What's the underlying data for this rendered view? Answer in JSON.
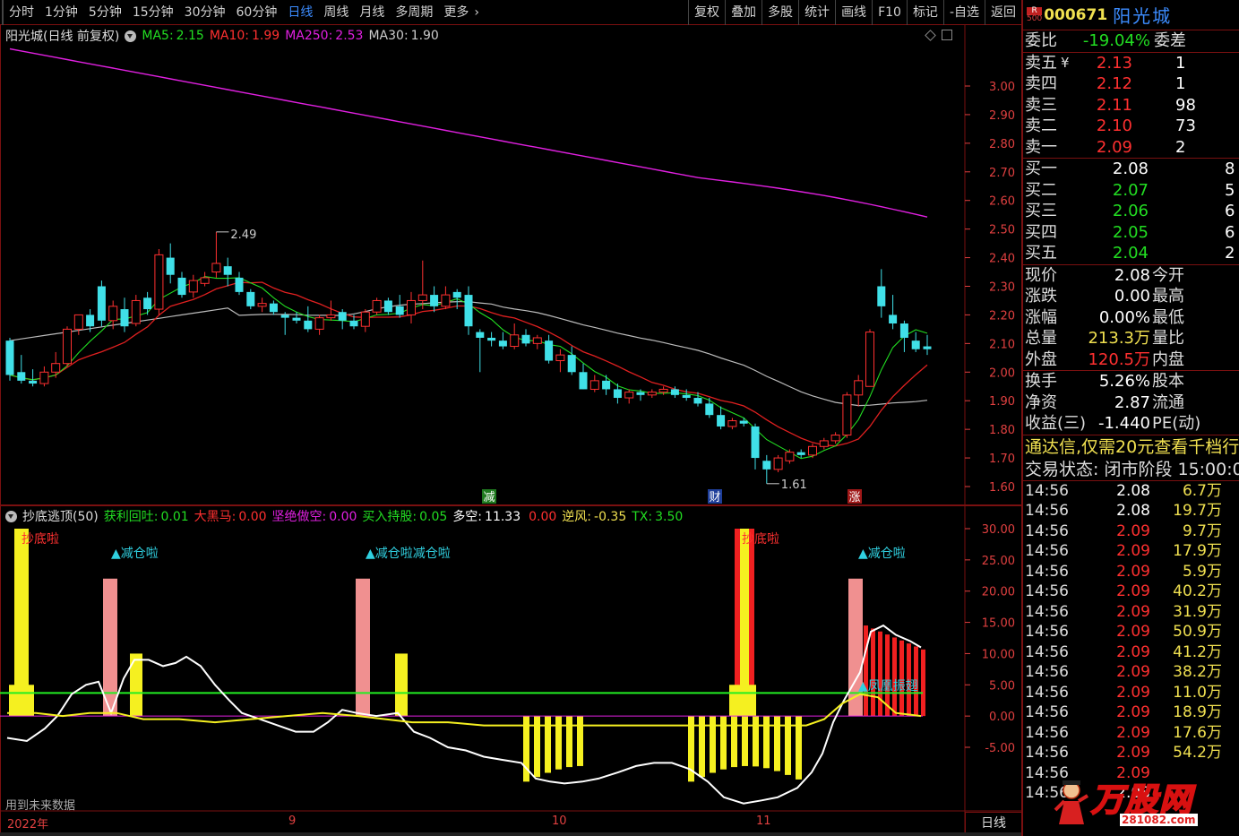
{
  "toolbar": {
    "tabs": [
      "分时",
      "1分钟",
      "5分钟",
      "15分钟",
      "30分钟",
      "60分钟",
      "日线",
      "周线",
      "月线",
      "多周期",
      "更多"
    ],
    "active_tab": "日线",
    "right_tools": [
      "复权",
      "叠加",
      "多股",
      "统计",
      "画线",
      "F10",
      "标记",
      "-自选",
      "返回"
    ]
  },
  "main_chart": {
    "title": "阳光城(日线 前复权)",
    "ma": [
      {
        "label": "MA5:",
        "value": "2.15",
        "color": "#22dd22"
      },
      {
        "label": "MA10:",
        "value": "1.99",
        "color": "#ff3030"
      },
      {
        "label": "MA250:",
        "value": "2.53",
        "color": "#e020e0"
      },
      {
        "label": "MA30:",
        "value": "1.90",
        "color": "#cccccc"
      }
    ],
    "y_ticks": [
      "3.00",
      "2.90",
      "2.80",
      "2.70",
      "2.60",
      "2.50",
      "2.40",
      "2.30",
      "2.20",
      "2.10",
      "2.00",
      "1.90",
      "1.80",
      "1.70",
      "1.60"
    ],
    "high_label": "2.49",
    "low_label": "1.61",
    "markers": [
      "减",
      "财",
      "涨"
    ]
  },
  "indicator": {
    "title": "抄底逃顶(50)",
    "fields": [
      {
        "label": "获利回吐:",
        "value": "0.01",
        "color": "#22dd22"
      },
      {
        "label": "大黑马:",
        "value": "0.00",
        "color": "#ff3030"
      },
      {
        "label": "坚绝做空:",
        "value": "0.00",
        "color": "#e020e0"
      },
      {
        "label": "买入持股:",
        "value": "0.05",
        "color": "#22dd22"
      },
      {
        "label": "多空:",
        "value": "11.33",
        "color": "#ffffff"
      },
      {
        "label": "",
        "value": "0.00",
        "color": "#ff3030"
      },
      {
        "label": "逆风:",
        "value": "-0.35",
        "color": "#f0e050"
      },
      {
        "label": "TX:",
        "value": "3.50",
        "color": "#22dd22"
      }
    ],
    "y_ticks": [
      "30.00",
      "25.00",
      "20.00",
      "15.00",
      "10.00",
      "5.00",
      "0.00",
      "-5.00"
    ],
    "annotations": [
      "抄底啦",
      "▲减仓啦",
      "▲减仓啦减仓啦",
      "抄底啦",
      "▲减仓啦",
      "▲凤凰振翅"
    ],
    "note": "用到未来数据"
  },
  "dates": [
    "2022年",
    "9",
    "10",
    "11"
  ],
  "period_label": "日线",
  "panel": {
    "rank_label": "R",
    "rank_value": "500",
    "code": "000671",
    "name": "阳光城",
    "weibi": {
      "label": "委比",
      "value": "-19.04%",
      "label2": "委差"
    },
    "asks": [
      {
        "label": "卖五",
        "mark": "¥",
        "price": "2.13",
        "vol": "1"
      },
      {
        "label": "卖四",
        "mark": "",
        "price": "2.12",
        "vol": "1"
      },
      {
        "label": "卖三",
        "mark": "",
        "price": "2.11",
        "vol": "98"
      },
      {
        "label": "卖二",
        "mark": "",
        "price": "2.10",
        "vol": "73"
      },
      {
        "label": "卖一",
        "mark": "",
        "price": "2.09",
        "vol": "2"
      }
    ],
    "bids": [
      {
        "label": "买一",
        "price": "2.08",
        "vol": "8"
      },
      {
        "label": "买二",
        "price": "2.07",
        "vol": "5"
      },
      {
        "label": "买三",
        "price": "2.06",
        "vol": "6"
      },
      {
        "label": "买四",
        "price": "2.05",
        "vol": "6"
      },
      {
        "label": "买五",
        "price": "2.04",
        "vol": "2"
      }
    ],
    "quote1": [
      {
        "l": "现价",
        "v": "2.08",
        "c": "white",
        "l2": "今开"
      },
      {
        "l": "涨跌",
        "v": "0.00",
        "c": "white",
        "l2": "最高"
      },
      {
        "l": "涨幅",
        "v": "0.00%",
        "c": "white",
        "l2": "最低"
      },
      {
        "l": "总量",
        "v": "213.3万",
        "c": "yellow",
        "l2": "量比"
      },
      {
        "l": "外盘",
        "v": "120.5万",
        "c": "red",
        "l2": "内盘"
      }
    ],
    "quote2": [
      {
        "l": "换手",
        "v": "5.26%",
        "c": "white",
        "l2": "股本"
      },
      {
        "l": "净资",
        "v": "2.87",
        "c": "white",
        "l2": "流通"
      },
      {
        "l": "收益(三)",
        "v": "-1.440",
        "c": "white",
        "l2": "PE(动)"
      }
    ],
    "ad": "通达信,仅需20元查看千档行",
    "state": "交易状态: 闭市阶段 15:00:0",
    "ticks": [
      {
        "t": "14:56",
        "p": "2.08",
        "c": "white",
        "v": "6.7万"
      },
      {
        "t": "14:56",
        "p": "2.08",
        "c": "white",
        "v": "19.7万"
      },
      {
        "t": "14:56",
        "p": "2.09",
        "c": "red",
        "v": "9.7万"
      },
      {
        "t": "14:56",
        "p": "2.09",
        "c": "red",
        "v": "17.9万"
      },
      {
        "t": "14:56",
        "p": "2.09",
        "c": "red",
        "v": "5.9万"
      },
      {
        "t": "14:56",
        "p": "2.09",
        "c": "red",
        "v": "40.2万"
      },
      {
        "t": "14:56",
        "p": "2.09",
        "c": "red",
        "v": "31.9万"
      },
      {
        "t": "14:56",
        "p": "2.09",
        "c": "red",
        "v": "50.9万"
      },
      {
        "t": "14:56",
        "p": "2.09",
        "c": "red",
        "v": "41.2万"
      },
      {
        "t": "14:56",
        "p": "2.09",
        "c": "red",
        "v": "38.2万"
      },
      {
        "t": "14:56",
        "p": "2.09",
        "c": "red",
        "v": "11.0万"
      },
      {
        "t": "14:56",
        "p": "2.09",
        "c": "red",
        "v": "18.9万"
      },
      {
        "t": "14:56",
        "p": "2.09",
        "c": "red",
        "v": "17.6万"
      },
      {
        "t": "14:56",
        "p": "2.09",
        "c": "red",
        "v": "54.2万"
      },
      {
        "t": "14:56",
        "p": "2.09",
        "c": "red",
        "v": ""
      },
      {
        "t": "14:56",
        "p": "2.08",
        "c": "white",
        "v": ""
      }
    ],
    "watermark": {
      "text": "万股网",
      "url": "281082.com"
    }
  },
  "colors": {
    "up": "#ff3030",
    "down": "#40e0e8",
    "ma5": "#22dd22",
    "ma10": "#e02020",
    "ma250": "#e020e0",
    "ma30": "#bbbbbb",
    "border": "#7a1010"
  }
}
